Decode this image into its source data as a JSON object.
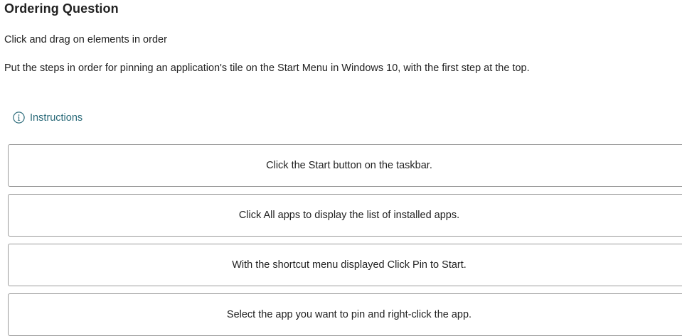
{
  "header": {
    "title": "Ordering Question"
  },
  "question": {
    "subtitle": "Click and drag on elements in order",
    "prompt": "Put the steps in order for pinning an application's tile on the Start Menu in Windows 10, with the first step at the top."
  },
  "instructions": {
    "label": "Instructions",
    "icon": "info-icon"
  },
  "items": [
    {
      "label": "Click the Start button on the taskbar."
    },
    {
      "label": "Click All apps to display the list of installed apps."
    },
    {
      "label": "With the shortcut menu displayed Click Pin to Start."
    },
    {
      "label": "Select the app you want to pin and right-click the app."
    }
  ],
  "colors": {
    "accent": "#2a6a79",
    "border": "#9a9a9a",
    "text": "#222222"
  }
}
